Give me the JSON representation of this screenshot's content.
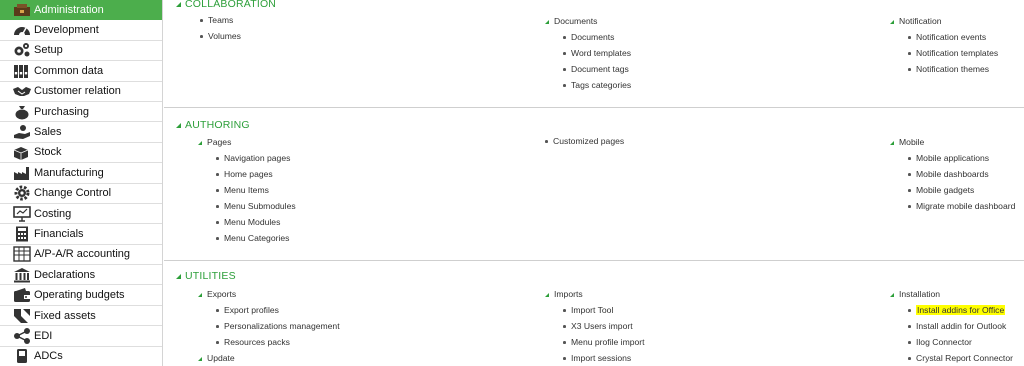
{
  "sidebar": {
    "items": [
      {
        "label": "Administration",
        "icon": "administration-icon"
      },
      {
        "label": "Development",
        "icon": "development-icon"
      },
      {
        "label": "Setup",
        "icon": "gears-icon"
      },
      {
        "label": "Common data",
        "icon": "binders-icon"
      },
      {
        "label": "Customer relation",
        "icon": "handshake-icon"
      },
      {
        "label": "Purchasing",
        "icon": "money-bag-icon"
      },
      {
        "label": "Sales",
        "icon": "sales-hand-icon"
      },
      {
        "label": "Stock",
        "icon": "boxes-icon"
      },
      {
        "label": "Manufacturing",
        "icon": "factory-icon"
      },
      {
        "label": "Change Control",
        "icon": "gear-icon"
      },
      {
        "label": "Costing",
        "icon": "presentation-icon"
      },
      {
        "label": "Financials",
        "icon": "calculator-icon"
      },
      {
        "label": "A/P-A/R accounting",
        "icon": "ledger-icon"
      },
      {
        "label": "Declarations",
        "icon": "building-icon"
      },
      {
        "label": "Operating budgets",
        "icon": "wallet-icon"
      },
      {
        "label": "Fixed assets",
        "icon": "assets-icon"
      },
      {
        "label": "EDI",
        "icon": "share-icon"
      },
      {
        "label": "ADCs",
        "icon": "adc-icon"
      }
    ]
  },
  "collaboration": {
    "title": "COLLABORATION",
    "col1": {
      "links": [
        "Teams",
        "Volumes"
      ]
    },
    "col2": {
      "group": "Documents",
      "links": [
        "Documents",
        "Word templates",
        "Document tags",
        "Tags categories"
      ]
    },
    "col3": {
      "group": "Notification",
      "links": [
        "Notification events",
        "Notification templates",
        "Notification themes"
      ]
    }
  },
  "authoring": {
    "title": "AUTHORING",
    "col1": {
      "group": "Pages",
      "links": [
        "Navigation pages",
        "Home pages",
        "Menu Items",
        "Menu Submodules",
        "Menu Modules",
        "Menu Categories"
      ]
    },
    "col2": {
      "links": [
        "Customized pages"
      ]
    },
    "col3": {
      "group": "Mobile",
      "links": [
        "Mobile applications",
        "Mobile dashboards",
        "Mobile gadgets",
        "Migrate mobile dashboard"
      ]
    }
  },
  "utilities": {
    "title": "UTILITIES",
    "col1": {
      "group": "Exports",
      "links": [
        "Export profiles",
        "Personalizations management",
        "Resources packs"
      ],
      "group2": "Update"
    },
    "col2": {
      "group": "Imports",
      "links": [
        "Import Tool",
        "X3 Users import",
        "Menu profile import",
        "Import sessions"
      ]
    },
    "col3": {
      "group": "Installation",
      "links": [
        "Install addins for Office",
        "Install addin for Outlook",
        "Ilog Connector",
        "Crystal Report Connector"
      ]
    }
  },
  "colors": {
    "accent": "#2d9f3a",
    "active_bg": "#4cae4c",
    "highlight": "#ffff00"
  }
}
